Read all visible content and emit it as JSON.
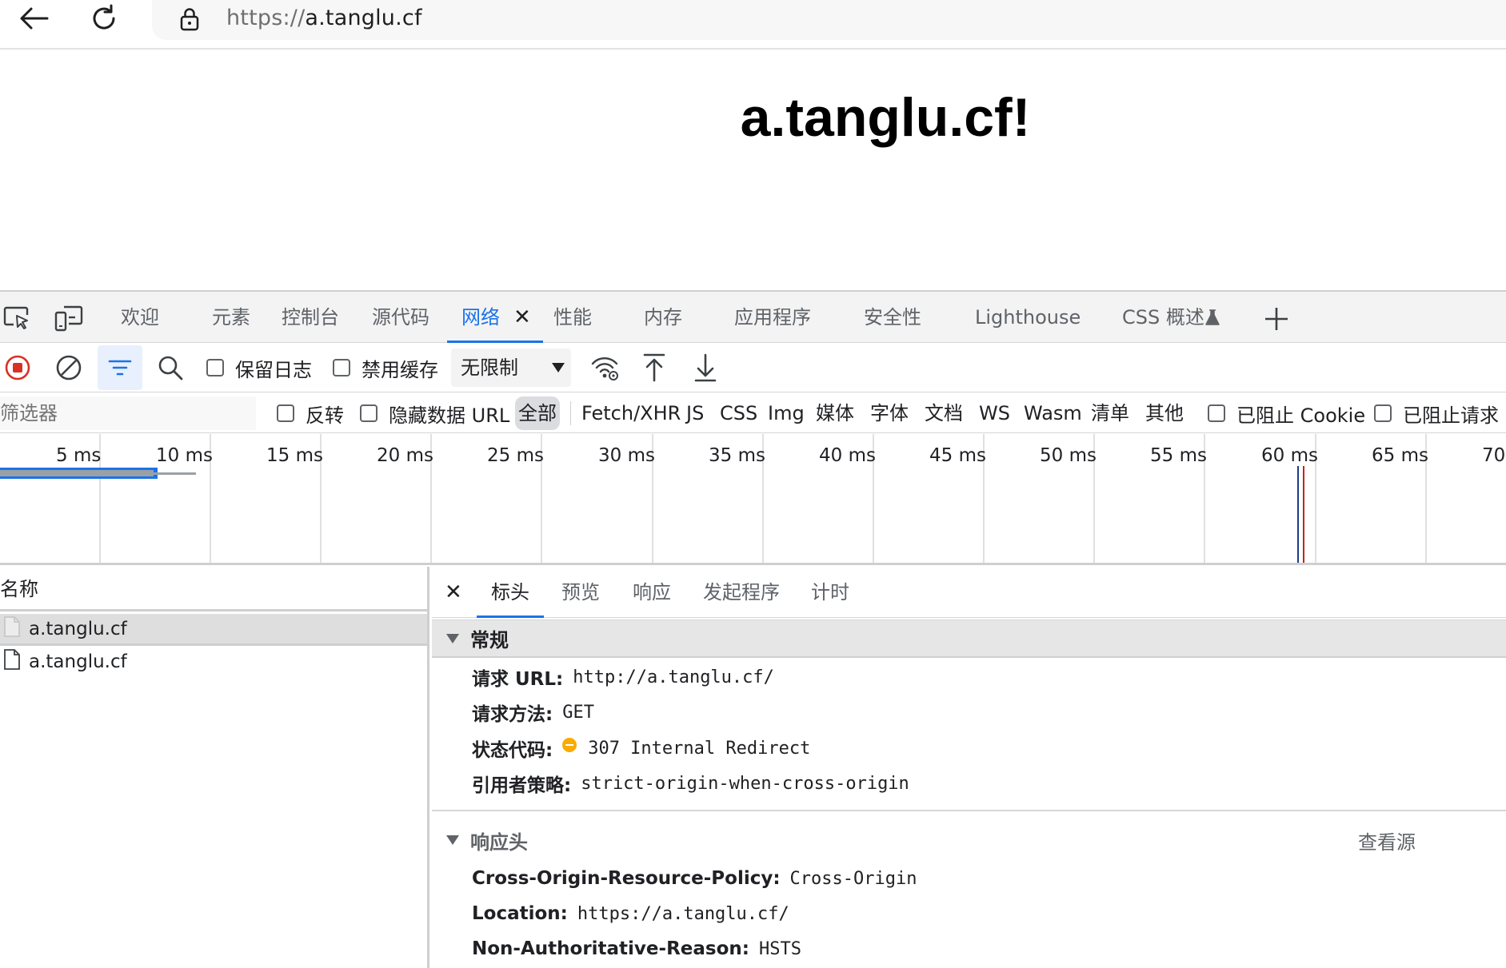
{
  "browser": {
    "url_protocol": "https://",
    "url_host": "a.tanglu.cf"
  },
  "page": {
    "heading": "a.tanglu.cf!"
  },
  "devtools": {
    "tabs": [
      "欢迎",
      "元素",
      "控制台",
      "源代码",
      "网络",
      "性能",
      "内存",
      "应用程序",
      "安全性",
      "Lighthouse",
      "CSS 概述"
    ],
    "active_tab": "网络",
    "toolbar": {
      "preserve_log": "保留日志",
      "disable_cache": "禁用缓存",
      "throttling": "无限制"
    },
    "filter": {
      "placeholder": "筛选器",
      "invert": "反转",
      "hide_data_urls": "隐藏数据 URL",
      "types": [
        "全部",
        "Fetch/XHR",
        "JS",
        "CSS",
        "Img",
        "媒体",
        "字体",
        "文档",
        "WS",
        "Wasm",
        "清单",
        "其他"
      ],
      "active_type": "全部",
      "blocked_cookies": "已阻止 Cookie",
      "blocked_requests": "已阻止请求"
    },
    "timeline": {
      "ticks": [
        "5 ms",
        "10 ms",
        "15 ms",
        "20 ms",
        "25 ms",
        "30 ms",
        "35 ms",
        "40 ms",
        "45 ms",
        "50 ms",
        "55 ms",
        "60 ms",
        "65 ms",
        "70"
      ]
    },
    "requests": {
      "column_name": "名称",
      "rows": [
        "a.tanglu.cf",
        "a.tanglu.cf"
      ],
      "selected_index": 0
    },
    "details": {
      "tabs": [
        "标头",
        "预览",
        "响应",
        "发起程序",
        "计时"
      ],
      "active_tab": "标头",
      "general": {
        "title": "常规",
        "request_url_label": "请求 URL:",
        "request_url": "http://a.tanglu.cf/",
        "method_label": "请求方法:",
        "method": "GET",
        "status_label": "状态代码:",
        "status": "307 Internal Redirect",
        "status_color": "#f9ab00",
        "referrer_label": "引用者策略:",
        "referrer": "strict-origin-when-cross-origin"
      },
      "response_headers": {
        "title": "响应头",
        "view_source": "查看源",
        "items": [
          {
            "name": "Cross-Origin-Resource-Policy:",
            "value": "Cross-Origin"
          },
          {
            "name": "Location:",
            "value": "https://a.tanglu.cf/"
          },
          {
            "name": "Non-Authoritative-Reason:",
            "value": "HSTS"
          }
        ]
      }
    }
  },
  "colors": {
    "accent": "#1a73e8",
    "record_red": "#d93025"
  }
}
